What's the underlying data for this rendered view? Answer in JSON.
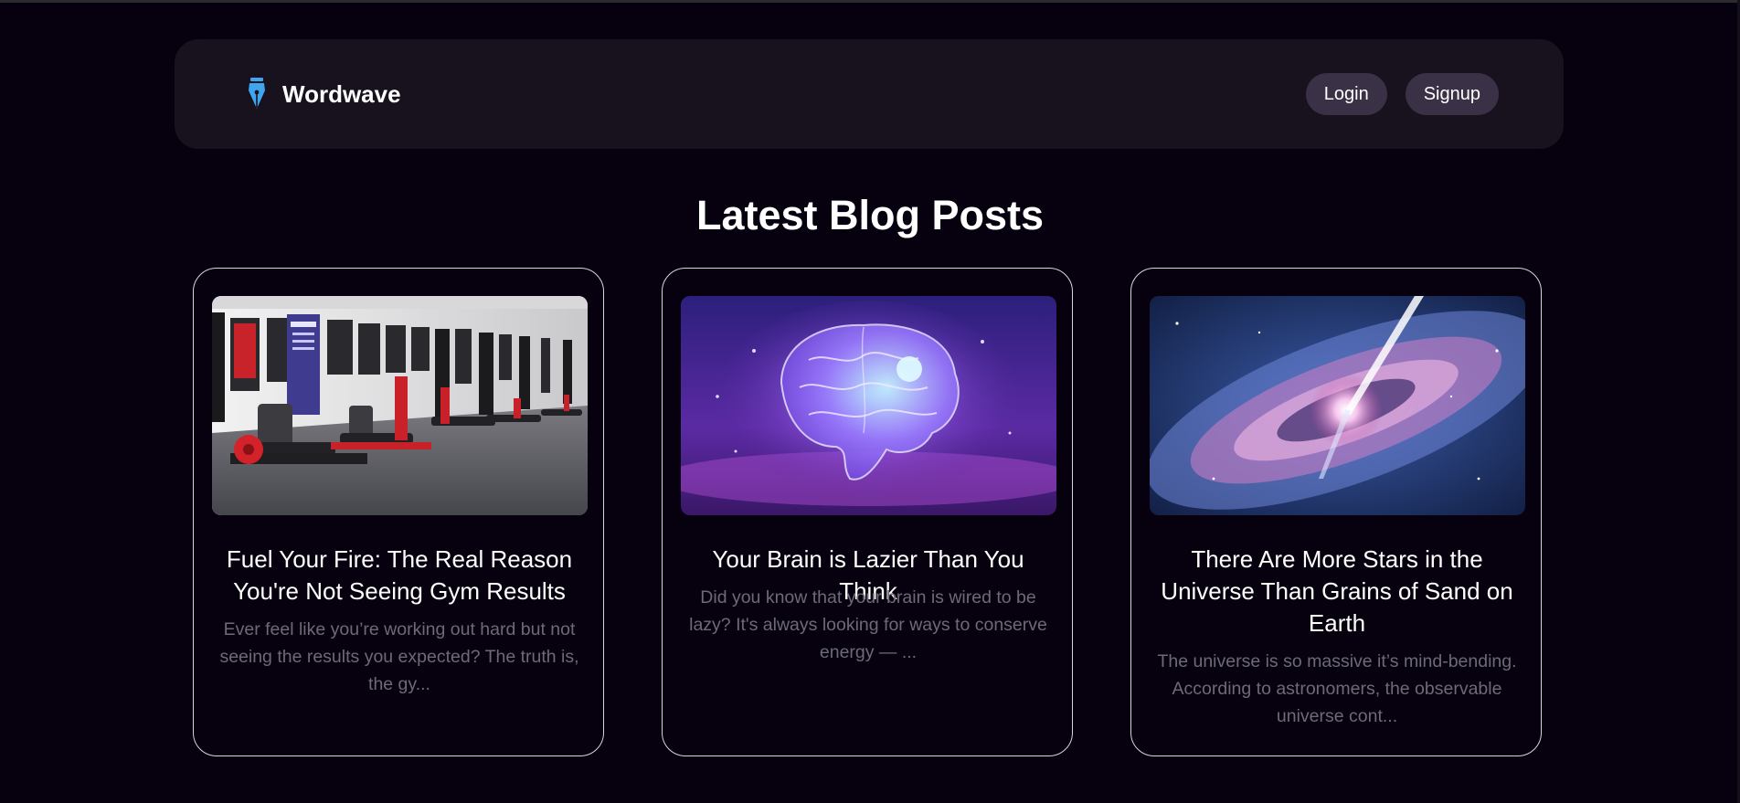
{
  "navbar": {
    "brand": "Wordwave",
    "brand_icon": "fountain-pen-nib-icon",
    "login_label": "Login",
    "signup_label": "Signup"
  },
  "main": {
    "title": "Latest Blog Posts",
    "posts": [
      {
        "title": "Fuel Your Fire: The Real Reason You're Not Seeing Gym Results",
        "excerpt": "Ever feel like you’re working out hard but not seeing the results you expected? The truth is, the gy...",
        "image": "gym-equipment-photo"
      },
      {
        "title": "Your Brain is Lazier Than You Think",
        "excerpt": "Did you know that your brain is wired to be lazy? It's always looking for ways to conserve energy — ...",
        "image": "glowing-brain-illustration"
      },
      {
        "title": "There Are More Stars in the Universe Than Grains of Sand on Earth",
        "excerpt": "The universe is so massive it’s mind-bending. According to astronomers, the observable universe cont...",
        "image": "galaxy-quasar-illustration"
      }
    ]
  },
  "colors": {
    "background": "#07010f",
    "navbar": "#18111e",
    "button": "#3b3146",
    "accent_icon": "#3fa6ee",
    "excerpt_text": "#6c6a78",
    "card_border": "#d9d4df"
  }
}
